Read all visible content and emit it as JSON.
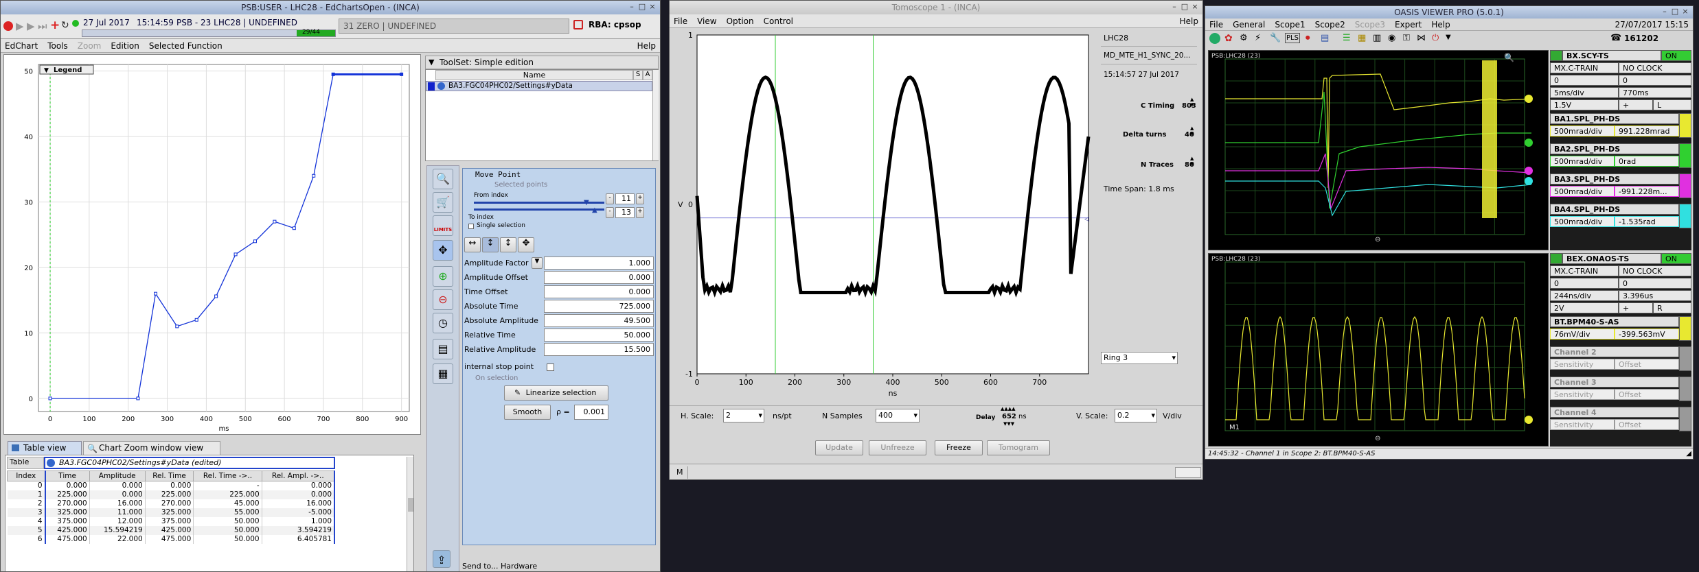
{
  "w1": {
    "title": "PSB:USER - LHC28 - EdChartsOpen - (INCA)",
    "date": "27 Jul 2017",
    "time": "15:14:59",
    "cycle": "PSB - 23 LHC28 | UNDEFINED",
    "counter": "29/44",
    "zero": "31 ZERO | UNDEFINED",
    "rba": "RBA: cpsop",
    "menu": [
      "EdChart",
      "Tools",
      "Zoom",
      "Edition",
      "Selected Function"
    ],
    "help": "Help",
    "legend": "Legend",
    "xunit": "ms",
    "tabs": [
      "Table view",
      "Chart Zoom window view"
    ],
    "table_title": "BA3.FGC04PHC02/Settings#yData  (edited)",
    "table_lbl": "Table",
    "table_cols": [
      "Index",
      "Time",
      "Amplitude",
      "Rel. Time",
      "Rel. Time ->..",
      "Rel. Ampl. ->.."
    ],
    "table_rows": [
      [
        "0",
        "0.000",
        "0.000",
        "0.000",
        "-",
        "0.000"
      ],
      [
        "1",
        "225.000",
        "0.000",
        "225.000",
        "225.000",
        "0.000"
      ],
      [
        "2",
        "270.000",
        "16.000",
        "270.000",
        "45.000",
        "16.000"
      ],
      [
        "3",
        "325.000",
        "11.000",
        "325.000",
        "55.000",
        "-5.000"
      ],
      [
        "4",
        "375.000",
        "12.000",
        "375.000",
        "50.000",
        "1.000"
      ],
      [
        "5",
        "425.000",
        "15.594219",
        "425.000",
        "50.000",
        "3.594219"
      ],
      [
        "6",
        "475.000",
        "22.000",
        "475.000",
        "50.000",
        "6.405781"
      ]
    ],
    "toolset": "ToolSet: Simple edition",
    "ts_cols": [
      "Name",
      "S",
      "A"
    ],
    "ts_row": "BA3.FGC04PHC02/Settings#yData",
    "move_title": "Move Point",
    "selected_points": "Selected points",
    "from_index": "From index",
    "from_val": "11",
    "to_val": "13",
    "to_index": "To index",
    "single_sel": "Single selection",
    "props": [
      [
        "Amplitude Factor",
        "1.000"
      ],
      [
        "Amplitude Offset",
        "0.000"
      ],
      [
        "Time Offset",
        "0.000"
      ],
      [
        "Absolute Time",
        "725.000"
      ],
      [
        "Absolute Amplitude",
        "49.500"
      ],
      [
        "Relative Time",
        "50.000"
      ],
      [
        "Relative Amplitude",
        "15.500"
      ]
    ],
    "stop_point": "internal stop point",
    "on_selection": "On selection",
    "linearize": "Linearize selection",
    "smooth": "Smooth",
    "rho_label": "ρ =",
    "rho": "0.001",
    "send": "Send to... Hardware",
    "limits": "LIMITS",
    "chart_data": {
      "type": "line",
      "xlabel": "ms",
      "x_ticks": [
        0,
        100,
        200,
        300,
        400,
        500,
        600,
        700,
        800,
        900
      ],
      "y_ticks": [
        0,
        10,
        20,
        30,
        40,
        50
      ],
      "xlim": [
        -30,
        920
      ],
      "ylim": [
        -2,
        51
      ],
      "series": [
        {
          "name": "BA3.FGC04PHC02/Settings#yData",
          "x": [
            0,
            225,
            270,
            325,
            375,
            425,
            475,
            525,
            575,
            625,
            675,
            725,
            900
          ],
          "y": [
            0,
            0,
            16,
            11,
            12,
            15.6,
            22,
            24,
            27,
            26,
            34,
            49.5,
            49.5
          ]
        }
      ],
      "legend": "Legend"
    }
  },
  "w2": {
    "title": "Tomoscope 1 - (INCA)",
    "menu": [
      "File",
      "View",
      "Option",
      "Control"
    ],
    "help": "Help",
    "plot": {
      "type": "line",
      "xlabel": "ns",
      "ylabel": "V",
      "x_ticks": [
        0,
        100,
        200,
        300,
        400,
        500,
        600,
        700
      ],
      "y_ticks": [
        "1",
        "0",
        "-1"
      ],
      "xlim": [
        0,
        800
      ],
      "ylim": [
        -1,
        1
      ],
      "markers": [
        160,
        360
      ]
    },
    "side": {
      "user": "LHC28",
      "device": "MD_MTE_H1_SYNC_20...",
      "ts": "15:14:57 27 Jul 2017",
      "ctiming_l": "C Timing",
      "ctiming": "803",
      "delta_l": "Delta turns",
      "delta": "40",
      "ntr_l": "N Traces",
      "ntr": "80",
      "span": "Time Span: 1.8 ms",
      "ring": "Ring 3"
    },
    "ctrl": {
      "hscale_l": "H. Scale:",
      "hscale": "2",
      "hunit": "ns/pt",
      "nsamp_l": "N Samples",
      "nsamp": "400",
      "delay_l": "Delay",
      "delay": "652",
      "delay_u": "ns",
      "vscale_l": "V. Scale:",
      "vscale": "0.2",
      "vunit": "V/div"
    },
    "buttons": [
      "Update",
      "Unfreeze",
      "Freeze",
      "Tomogram"
    ],
    "mode": "M"
  },
  "w3": {
    "title": "OASIS VIEWER PRO (5.0.1)",
    "date": "27/07/2017 15:15",
    "phone": "161202",
    "menu": [
      "File",
      "General",
      "Scope1",
      "Scope2",
      "Scope3",
      "Expert",
      "Help"
    ],
    "s1": {
      "label": "PSB:LHC28 (23)",
      "src": "BX.SCY-TS",
      "on": "ON",
      "train": "MX.C-TRAIN",
      "clock": "NO CLOCK",
      "z1": "0",
      "z2": "0",
      "tdiv": "5ms/div",
      "tval": "770ms",
      "v": "1.5V",
      "pm": "+",
      "l": "L",
      "ch": [
        {
          "name": "BA1.SPL_PH-DS",
          "div": "500mrad/div",
          "val": "991.228mrad",
          "color": "#e8e830"
        },
        {
          "name": "BA2.SPL_PH-DS",
          "div": "500mrad/div",
          "val": "0rad",
          "color": "#30d030"
        },
        {
          "name": "BA3.SPL_PH-DS",
          "div": "500mrad/div",
          "val": "-991.228m...",
          "color": "#e030e0"
        },
        {
          "name": "BA4.SPL_PH-DS",
          "div": "500mrad/div",
          "val": "-1.535rad",
          "color": "#30e0e0"
        }
      ]
    },
    "s2": {
      "label": "PSB:LHC28 (23)",
      "src": "BEX.ONAOS-TS",
      "on": "ON",
      "train": "MX.C-TRAIN",
      "clock": "NO CLOCK",
      "z1": "0",
      "z2": "0",
      "tdiv": "244ns/div",
      "tval": "3.396us",
      "v": "2V",
      "pm": "+",
      "r": "R",
      "m1": "M1",
      "ch": [
        {
          "name": "BT.BPM40-S-AS",
          "div": "76mV/div",
          "val": "-399.563mV",
          "color": "#e8e830"
        },
        {
          "name": "Channel 2",
          "div": "Sensitivity",
          "val": "Offset",
          "color": "#999"
        },
        {
          "name": "Channel 3",
          "div": "Sensitivity",
          "val": "Offset",
          "color": "#999"
        },
        {
          "name": "Channel 4",
          "div": "Sensitivity",
          "val": "Offset",
          "color": "#999"
        }
      ]
    },
    "status": "14:45:32 - Channel 1 in Scope 2: BT.BPM40-S-AS"
  }
}
